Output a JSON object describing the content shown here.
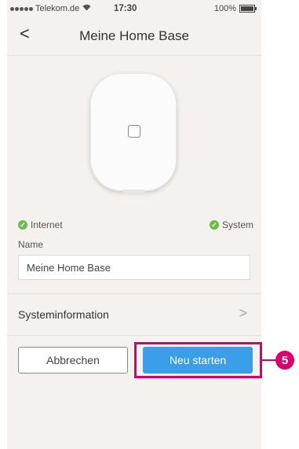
{
  "status_bar": {
    "carrier": "Telekom.de",
    "time": "17:30",
    "battery": "100%"
  },
  "navbar": {
    "back_glyph": "<",
    "title": "Meine Home Base"
  },
  "status": {
    "internet_label": "Internet",
    "system_label": "System",
    "ok_color": "#6abf4b"
  },
  "name_field": {
    "label": "Name",
    "value": "Meine Home Base"
  },
  "system_info": {
    "label": "Systeminformation",
    "chevron": ">"
  },
  "actions": {
    "cancel_label": "Abbrechen",
    "restart_label": "Neu starten",
    "restart_color": "#3a9ee8"
  },
  "annotation": {
    "number": "5",
    "color": "#d6006e"
  }
}
